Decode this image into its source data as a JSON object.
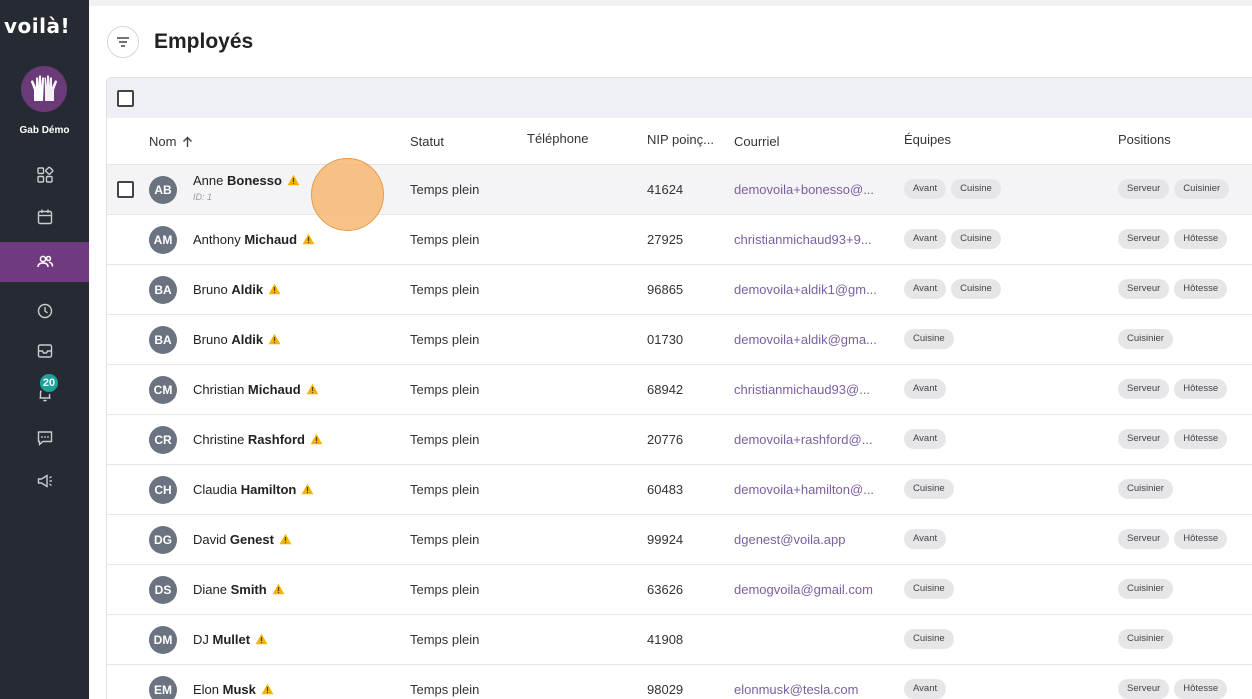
{
  "app": {
    "logo": "voilà!"
  },
  "sidebar": {
    "org_name": "Gab Démo",
    "items": [
      {
        "icon": "dashboard-icon"
      },
      {
        "icon": "calendar-icon"
      },
      {
        "icon": "employees-icon",
        "active": true
      },
      {
        "icon": "clock-icon"
      },
      {
        "icon": "inbox-icon"
      },
      {
        "icon": "bell-icon",
        "badge": "20"
      },
      {
        "icon": "chat-icon"
      },
      {
        "icon": "megaphone-icon"
      }
    ]
  },
  "header": {
    "title": "Employés",
    "filter_icon": "filter-icon"
  },
  "table": {
    "columns": {
      "name": "Nom",
      "status": "Statut",
      "phone": "Téléphone",
      "nip": "NIP poinç...",
      "email": "Courriel",
      "teams": "Équipes",
      "positions": "Positions"
    },
    "rows": [
      {
        "initials": "AB",
        "first": "Anne",
        "last": "Bonesso",
        "sub": "ID: 1",
        "status": "Temps plein",
        "nip": "41624",
        "email": "demovoila+bonesso@...",
        "teams": [
          "Avant",
          "Cuisine"
        ],
        "positions": [
          "Serveur",
          "Cuisinier"
        ]
      },
      {
        "initials": "AM",
        "first": "Anthony",
        "last": "Michaud",
        "status": "Temps plein",
        "nip": "27925",
        "email": "christianmichaud93+9...",
        "teams": [
          "Avant",
          "Cuisine"
        ],
        "positions": [
          "Serveur",
          "Hôtesse"
        ]
      },
      {
        "initials": "BA",
        "first": "Bruno",
        "last": "Aldik",
        "status": "Temps plein",
        "nip": "96865",
        "email": "demovoila+aldik1@gm...",
        "teams": [
          "Avant",
          "Cuisine"
        ],
        "positions": [
          "Serveur",
          "Hôtesse"
        ]
      },
      {
        "initials": "BA",
        "first": "Bruno",
        "last": "Aldik",
        "status": "Temps plein",
        "nip": "01730",
        "email": "demovoila+aldik@gma...",
        "teams": [
          "Cuisine"
        ],
        "positions": [
          "Cuisinier"
        ]
      },
      {
        "initials": "CM",
        "first": "Christian",
        "last": "Michaud",
        "status": "Temps plein",
        "nip": "68942",
        "email": "christianmichaud93@...",
        "teams": [
          "Avant"
        ],
        "positions": [
          "Serveur",
          "Hôtesse"
        ]
      },
      {
        "initials": "CR",
        "first": "Christine",
        "last": "Rashford",
        "status": "Temps plein",
        "nip": "20776",
        "email": "demovoila+rashford@...",
        "teams": [
          "Avant"
        ],
        "positions": [
          "Serveur",
          "Hôtesse"
        ]
      },
      {
        "initials": "CH",
        "first": "Claudia",
        "last": "Hamilton",
        "status": "Temps plein",
        "nip": "60483",
        "email": "demovoila+hamilton@...",
        "teams": [
          "Cuisine"
        ],
        "positions": [
          "Cuisinier"
        ]
      },
      {
        "initials": "DG",
        "first": "David",
        "last": "Genest",
        "status": "Temps plein",
        "nip": "99924",
        "email": "dgenest@voila.app",
        "teams": [
          "Avant"
        ],
        "positions": [
          "Serveur",
          "Hôtesse"
        ]
      },
      {
        "initials": "DS",
        "first": "Diane",
        "last": "Smith",
        "status": "Temps plein",
        "nip": "63626",
        "email": "demogvoila@gmail.com",
        "teams": [
          "Cuisine"
        ],
        "positions": [
          "Cuisinier"
        ]
      },
      {
        "initials": "DM",
        "first": "DJ",
        "last": "Mullet",
        "status": "Temps plein",
        "nip": "41908",
        "email": "",
        "teams": [
          "Cuisine"
        ],
        "positions": [
          "Cuisinier"
        ]
      },
      {
        "initials": "EM",
        "first": "Elon",
        "last": "Musk",
        "status": "Temps plein",
        "nip": "98029",
        "email": "elonmusk@tesla.com",
        "teams": [
          "Avant"
        ],
        "positions": [
          "Serveur",
          "Hôtesse"
        ]
      }
    ]
  },
  "colors": {
    "sidebar": "#262b33",
    "active": "#6f3a7f",
    "badge": "#1aa39a",
    "email": "#7b5fa0",
    "warning": "#f5b400"
  }
}
